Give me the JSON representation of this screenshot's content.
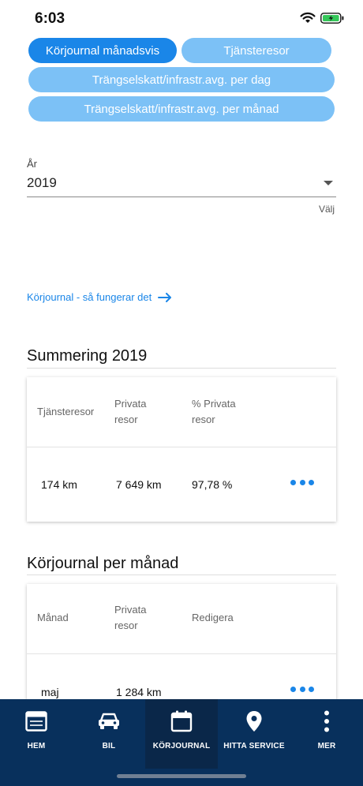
{
  "status_bar": {
    "time": "6:03"
  },
  "tabs_top": [
    {
      "label": "Körjournal månadsvis",
      "active": true
    },
    {
      "label": "Tjänsteresor",
      "active": false
    },
    {
      "label": "Trängselskatt/infrastr.avg. per dag",
      "active": false
    },
    {
      "label": "Trängselskatt/infrastr.avg. per månad",
      "active": false
    }
  ],
  "year_select": {
    "label": "År",
    "value": "2019",
    "helper": "Välj"
  },
  "info_link": {
    "label": "Körjournal - så fungerar det"
  },
  "summary": {
    "title": "Summering 2019",
    "headers": [
      "Tjänsteresor",
      "Privata resor",
      "% Privata resor"
    ],
    "row": [
      "174 km",
      "7 649 km",
      "97,78 %"
    ]
  },
  "monthly": {
    "title": "Körjournal per månad",
    "headers": [
      "Månad",
      "Privata resor",
      "Redigera"
    ],
    "rows": [
      {
        "month": "maj",
        "private": "1 284 km"
      }
    ]
  },
  "bottom_nav": [
    {
      "label": "HEM",
      "icon": "browser-window-icon",
      "active": false
    },
    {
      "label": "BIL",
      "icon": "car-icon",
      "active": false
    },
    {
      "label": "KÖRJOURNAL",
      "icon": "calendar-icon",
      "active": true
    },
    {
      "label": "HITTA SERVICE",
      "icon": "location-pin-icon",
      "active": false
    },
    {
      "label": "MER",
      "icon": "more-vertical-icon",
      "active": false
    }
  ],
  "colors": {
    "accent": "#1a86e8",
    "chip_inactive": "#7cc1f6",
    "nav_bg": "#08305c",
    "battery": "#34c759"
  }
}
